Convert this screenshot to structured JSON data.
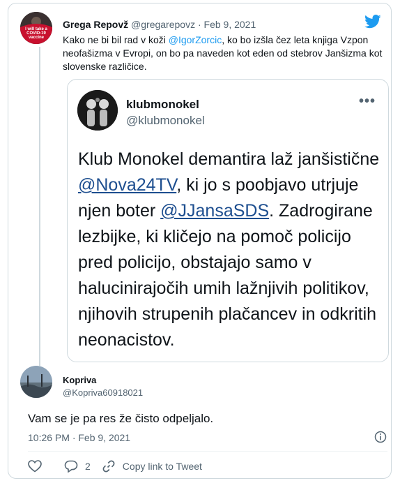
{
  "tweet": {
    "author_name": "Grega Repovž",
    "author_handle": "@gregarepovz",
    "separator": "·",
    "date": "Feb 9, 2021",
    "avatar_badge_text": "I will take a COVID-19 vaccine",
    "text_before": "Kako ne bi bil rad v koži ",
    "mention": "@IgorZorcic",
    "text_after": ", ko bo izšla čez leta knjiga Vzpon neofašizma v Evropi, on bo pa naveden kot eden od stebrov Janšizma kot slovenske različice."
  },
  "quoted": {
    "name": "klubmonokel",
    "handle": "@klubmonokel",
    "more": "•••",
    "text_1": "Klub Monokel demantira laž janšistične ",
    "mention_1": "@Nova24TV",
    "text_2": ", ki jo s poobjavo utrjuje njen boter ",
    "mention_2": "@JJansaSDS",
    "text_3": ". Zadrogirane lezbijke, ki kličejo na pomoč policijo pred policijo, obstajajo samo v halucinirajočih umih lažnjivih politikov, njihovih strupenih plačancev in odkritih neonacistov."
  },
  "reply": {
    "name": "Kopriva",
    "handle": "@Kopriva60918021",
    "text": "Vam se je pa res že čisto odpeljalo.",
    "time": "10:26 PM · Feb 9, 2021"
  },
  "actions": {
    "reply_count": "2",
    "copy_link": "Copy link to Tweet"
  },
  "colors": {
    "twitter_blue": "#1d9bf0",
    "badge_red": "#c8102e"
  }
}
